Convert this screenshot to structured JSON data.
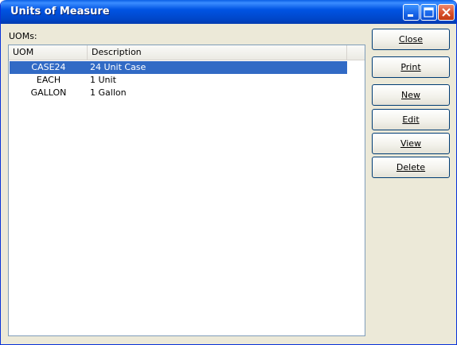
{
  "window": {
    "title": "Units of Measure"
  },
  "list_label": "UOMs:",
  "table": {
    "columns": [
      "UOM",
      "Description"
    ],
    "rows": [
      {
        "uom": "CASE24",
        "description": "24 Unit Case",
        "selected": true
      },
      {
        "uom": "EACH",
        "description": "1 Unit",
        "selected": false
      },
      {
        "uom": "GALLON",
        "description": "1 Gallon",
        "selected": false
      }
    ]
  },
  "buttons": {
    "close": "Close",
    "print": "Print",
    "new": "New",
    "edit": "Edit",
    "view": "View",
    "delete": "Delete"
  },
  "colors": {
    "selection": "#316ac5",
    "titlebar": "#0054e3"
  },
  "icons": [
    "minimize-icon",
    "maximize-icon",
    "close-icon"
  ]
}
